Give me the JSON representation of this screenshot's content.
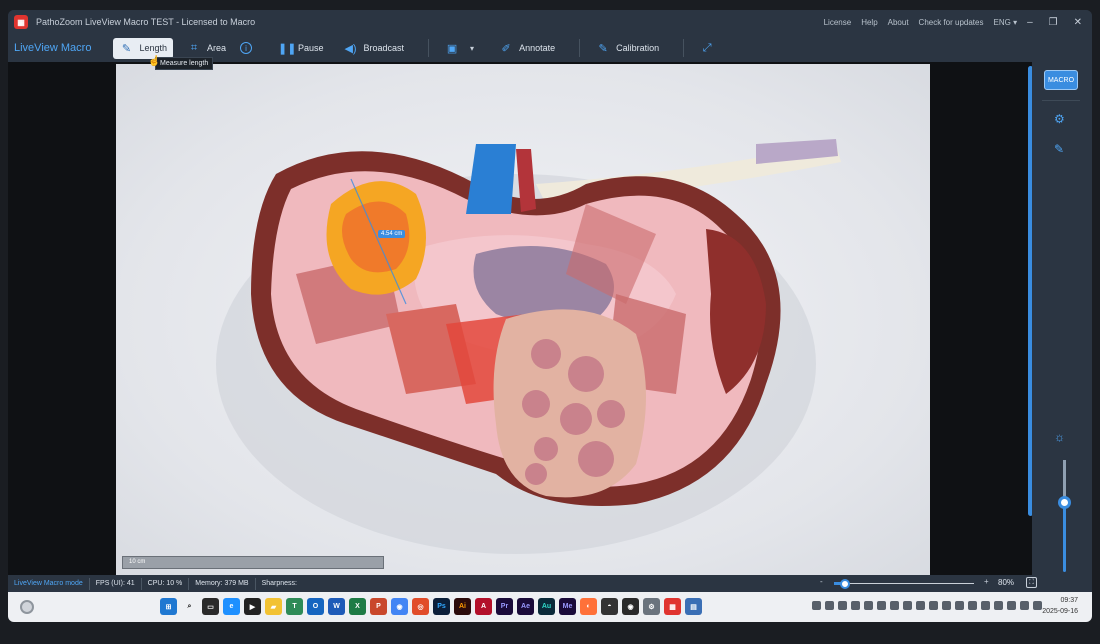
{
  "titlebar": {
    "title": "PathoZoom LiveView Macro TEST - Licensed to Macro",
    "links": [
      "License",
      "Help",
      "About",
      "Check for updates",
      "ENG"
    ],
    "language_dropdown_icon": "caret-down-icon",
    "window_controls": [
      "minimize-icon",
      "restore-icon",
      "close-icon"
    ]
  },
  "toolbar": {
    "brand": "LiveView Macro",
    "length_label": "Length",
    "area_label": "Area",
    "pause_label": "Pause",
    "broadcast_label": "Broadcast",
    "annotate_label": "Annotate",
    "calibration_label": "Calibration",
    "tooltip": "Measure length"
  },
  "image": {
    "measurement": "4.54 cm",
    "scalebar_label": "10 cm"
  },
  "rightpanel": {
    "macro_label": "MACRO"
  },
  "status": {
    "mode": "LiveView Macro mode",
    "fps": "FPS (UI): 41",
    "cpu": "CPU: 10 %",
    "memory": "Memory: 379   MB",
    "sharpness": "Sharpness:",
    "zoom_minus": "-",
    "zoom_plus": "+",
    "zoom": "80%",
    "zoom_level": 0.08
  },
  "taskbar": {
    "time": "09:37",
    "date": "2025-09-16"
  },
  "colors": {
    "accent": "#3a8de0",
    "chrome": "#2b3542",
    "brand_text": "#4fa6f5"
  }
}
